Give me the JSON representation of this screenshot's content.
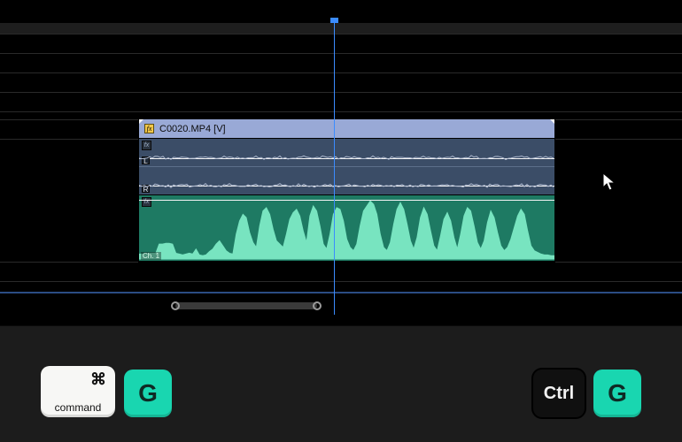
{
  "clip": {
    "video_label": "C0020.MP4 [V]",
    "fx_glyph": "fx",
    "stereo_L": "L",
    "stereo_R": "R",
    "mono_channel_label": "Ch. 1"
  },
  "shortcuts": {
    "mac_modifier_symbol": "⌘",
    "mac_modifier_word": "command",
    "mac_key": "G",
    "win_modifier": "Ctrl",
    "win_key": "G"
  },
  "colors": {
    "playhead": "#3b8cff",
    "video_clip": "#99a9d6",
    "stereo_audio": "#3b4d67",
    "mono_audio": "#1e7a63",
    "mono_waveform": "#78e4c0",
    "accent_key": "#19d6b0"
  },
  "waveform": {
    "stereo_noise_amp": 2,
    "mono": [
      6,
      6,
      6,
      7,
      7,
      7,
      18,
      18,
      19,
      19,
      18,
      7,
      6,
      5,
      6,
      7,
      6,
      12,
      5,
      4,
      5,
      9,
      12,
      18,
      22,
      16,
      10,
      7,
      6,
      30,
      46,
      54,
      50,
      32,
      20,
      14,
      40,
      58,
      62,
      54,
      36,
      22,
      18,
      14,
      30,
      48,
      56,
      60,
      52,
      34,
      20,
      52,
      64,
      58,
      40,
      18,
      12,
      30,
      54,
      62,
      60,
      46,
      24,
      14,
      10,
      18,
      40,
      58,
      64,
      70,
      66,
      54,
      30,
      14,
      10,
      20,
      42,
      60,
      68,
      60,
      42,
      22,
      12,
      26,
      50,
      62,
      54,
      34,
      16,
      10,
      28,
      48,
      56,
      46,
      26,
      12,
      30,
      52,
      62,
      58,
      40,
      20,
      12,
      22,
      44,
      58,
      50,
      32,
      16,
      10,
      14,
      24,
      38,
      52,
      60,
      54,
      34,
      16,
      10,
      8,
      6,
      5,
      5,
      4,
      4
    ]
  }
}
